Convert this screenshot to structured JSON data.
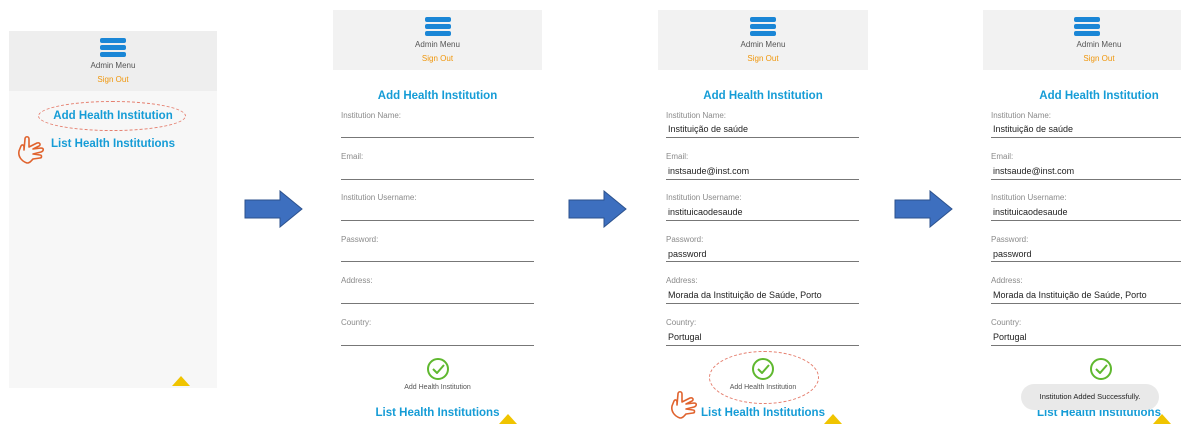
{
  "header": {
    "menu_title": "Admin Menu",
    "sign_out": "Sign Out"
  },
  "admin_menu": {
    "add_link": "Add Health Institution",
    "list_link": "List Health Institutions"
  },
  "form": {
    "title": "Add Health Institution",
    "fields": [
      {
        "label": "Institution Name:",
        "value": "Instituição de saúde"
      },
      {
        "label": "Email:",
        "value": "instsaude@inst.com"
      },
      {
        "label": "Institution Username:",
        "value": "instituicaodesaude"
      },
      {
        "label": "Password:",
        "value": "password"
      },
      {
        "label": "Address:",
        "value": "Morada da Instituição de Saúde, Porto"
      },
      {
        "label": "Country:",
        "value": "Portugal"
      }
    ],
    "submit_label": "Add Health Institution",
    "list_link": "List Health Institutions"
  },
  "toast": {
    "message": "Institution Added Successfully."
  },
  "colors": {
    "accent_blue": "#159cd6",
    "hamburger_blue": "#1a86d6",
    "sign_out_orange": "#f0960a",
    "success_green": "#5fb82f",
    "flow_arrow": "#3d6fbf",
    "pointer_orange": "#e0632e",
    "triangle_yellow": "#f0c400"
  },
  "icons": {
    "menu": "hamburger-icon",
    "submit": "check-circle-icon",
    "flow": "right-arrow-icon",
    "pointer": "hand-pointer-icon"
  }
}
